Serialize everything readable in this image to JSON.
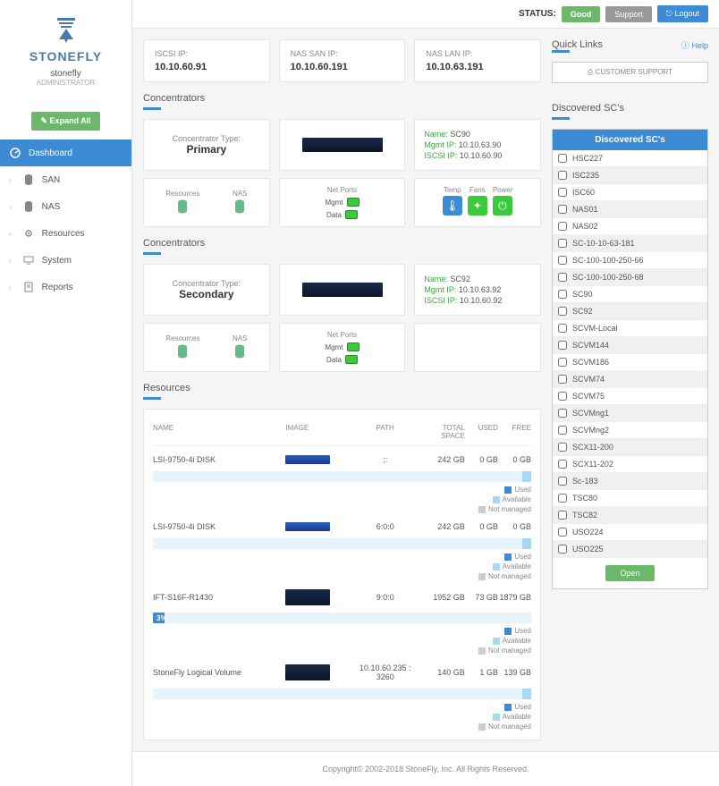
{
  "brand": "STONEFLY",
  "user": {
    "name": "stonefly",
    "role": "ADMINISTRATOR"
  },
  "sidebar": {
    "expand_label": "✎ Expand All",
    "items": [
      {
        "label": "Dashboard"
      },
      {
        "label": "SAN"
      },
      {
        "label": "NAS"
      },
      {
        "label": "Resources"
      },
      {
        "label": "System"
      },
      {
        "label": "Reports"
      }
    ]
  },
  "topbar": {
    "status_label": "STATUS:",
    "good": "Good",
    "support": "Support",
    "logout": "⎋ Logout"
  },
  "ips": [
    {
      "label": "ISCSI IP:",
      "value": "10.10.60.91"
    },
    {
      "label": "NAS SAN IP:",
      "value": "10.10.60.191"
    },
    {
      "label": "NAS LAN IP:",
      "value": "10.10.63.191"
    }
  ],
  "sections": {
    "concentrators": "Concentrators",
    "resources": "Resources"
  },
  "concentrators": [
    {
      "type_label": "Concentrator Type:",
      "type": "Primary",
      "info": {
        "name_k": "Name:",
        "name_v": "SC90",
        "mgmt_k": "Mgmt IP:",
        "mgmt_v": "10.10.63.90",
        "iscsi_k": "ISCSI IP:",
        "iscsi_v": "10.10.60.90"
      },
      "resources_label": "Resources",
      "nas_label": "NAS",
      "netports_label": "Net Ports",
      "mgmt_port": "Mgmt",
      "data_port": "Data",
      "stats": {
        "temp": "Temp",
        "fans": "Fans",
        "power": "Power"
      }
    },
    {
      "type_label": "Concentrator Type:",
      "type": "Secondary",
      "info": {
        "name_k": "Name:",
        "name_v": "SC92",
        "mgmt_k": "Mgmt IP:",
        "mgmt_v": "10.10.63.92",
        "iscsi_k": "ISCSI IP:",
        "iscsi_v": "10.10.60.92"
      },
      "resources_label": "Resources",
      "nas_label": "NAS",
      "netports_label": "Net Ports",
      "mgmt_port": "Mgmt",
      "data_port": "Data"
    }
  ],
  "resources_table": {
    "headers": {
      "name": "NAME",
      "image": "IMAGE",
      "path": "PATH",
      "total": "TOTAL SPACE",
      "used": "USED",
      "free": "FREE"
    },
    "rows": [
      {
        "name": "LSI-9750-4i DISK",
        "path": "::",
        "total": "242 GB",
        "used": "0 GB",
        "free": "0 GB",
        "image": "blue-sm",
        "progress": ""
      },
      {
        "name": "LSI-9750-4i DISK",
        "path": "6:0:0",
        "total": "242 GB",
        "used": "0 GB",
        "free": "0 GB",
        "image": "blue-sm",
        "progress": ""
      },
      {
        "name": "IFT-S16F-R1430",
        "path": "9:0:0",
        "total": "1952 GB",
        "used": "73 GB",
        "free": "1879 GB",
        "image": "dark",
        "progress": "3%"
      },
      {
        "name": "StoneFly Logical Volume",
        "path": "10.10.60.235 : 3260",
        "total": "140 GB",
        "used": "1 GB",
        "free": "139 GB",
        "image": "dark",
        "progress": ""
      }
    ],
    "legend": {
      "used": "Used",
      "available": "Available",
      "not_managed": "Not managed"
    }
  },
  "quicklinks": {
    "title": "Quick Links",
    "help": "Help",
    "support_btn": "⎙ CUSTOMER SUPPORT"
  },
  "discovered": {
    "title": "Discovered SC's",
    "header": "Discovered SC's",
    "items": [
      "HSC227",
      "ISC235",
      "ISC60",
      "NAS01",
      "NAS02",
      "SC-10-10-63-181",
      "SC-100-100-250-66",
      "SC-100-100-250-68",
      "SC90",
      "SC92",
      "SCVM-Local",
      "SCVM144",
      "SCVM186",
      "SCVM74",
      "SCVM75",
      "SCVMng1",
      "SCVMng2",
      "SCX11-200",
      "SCX11-202",
      "Sc-183",
      "TSC80",
      "TSC82",
      "USO224",
      "USO225"
    ],
    "open": "Open"
  },
  "footer": "Copyright© 2002-2018 StoneFly, Inc. All Rights Reserved."
}
